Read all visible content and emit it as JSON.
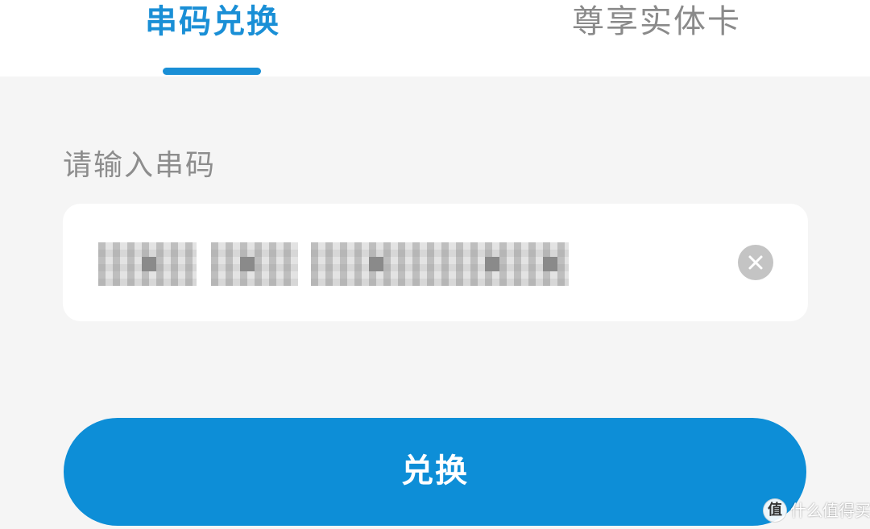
{
  "tabs": [
    {
      "label": "串码兑换",
      "active": true
    },
    {
      "label": "尊享实体卡",
      "active": false
    }
  ],
  "form": {
    "label": "请输入串码",
    "code_value": "",
    "clear_icon": "close-icon"
  },
  "actions": {
    "redeem_label": "兑换"
  },
  "watermark": {
    "logo_text": "值",
    "text": "什么值得买"
  },
  "colors": {
    "accent": "#1a8fd6",
    "button": "#0d8ed7",
    "background": "#f5f5f5",
    "inactive_tab": "#8a8a8a",
    "label": "#8d8d8d"
  }
}
